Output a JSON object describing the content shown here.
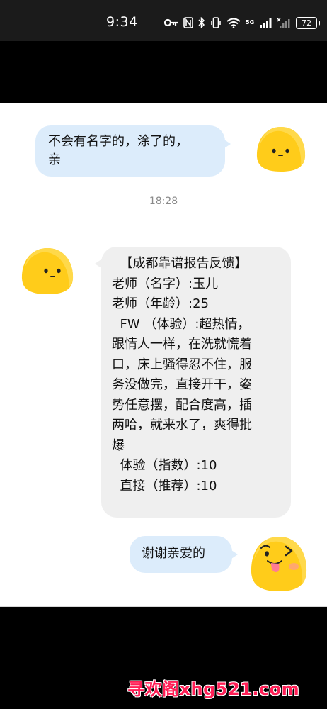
{
  "status_bar": {
    "time": "9:34",
    "network_label": "5G",
    "battery": "72"
  },
  "messages": [
    {
      "side": "right",
      "lines": [
        "不会有名字的，涂了的，",
        "亲"
      ]
    },
    {
      "side": "left",
      "lines": [
        "  【成都靠谱报告反馈】",
        "老师（名字）:玉儿",
        "老师（年龄）:25",
        "  FW （体验）:超热情，",
        "跟情人一样，在洗就慌着",
        "口，床上骚得忍不住，服",
        "务没做完，直接开干，姿",
        "势任意摆，配合度高，插",
        "两哈，就来水了，爽得批",
        "爆",
        "  体验（指数）:10",
        "  直接（推荐）:10"
      ]
    },
    {
      "side": "right",
      "lines": [
        "谢谢亲爱的"
      ]
    }
  ],
  "timestamp": "18:28",
  "watermark": "寻欢阁xhg521.com",
  "colors": {
    "outgoing_bubble": "#dcecfb",
    "incoming_bubble": "#efefef",
    "avatar_yellow": "#ffcc1a",
    "watermark": "#ff1f56"
  },
  "icons": [
    "key-icon",
    "nfc-icon",
    "bluetooth-icon",
    "vibrate-icon",
    "wifi-icon",
    "signal-icon",
    "battery-icon",
    "avatar-emoji-icon"
  ]
}
